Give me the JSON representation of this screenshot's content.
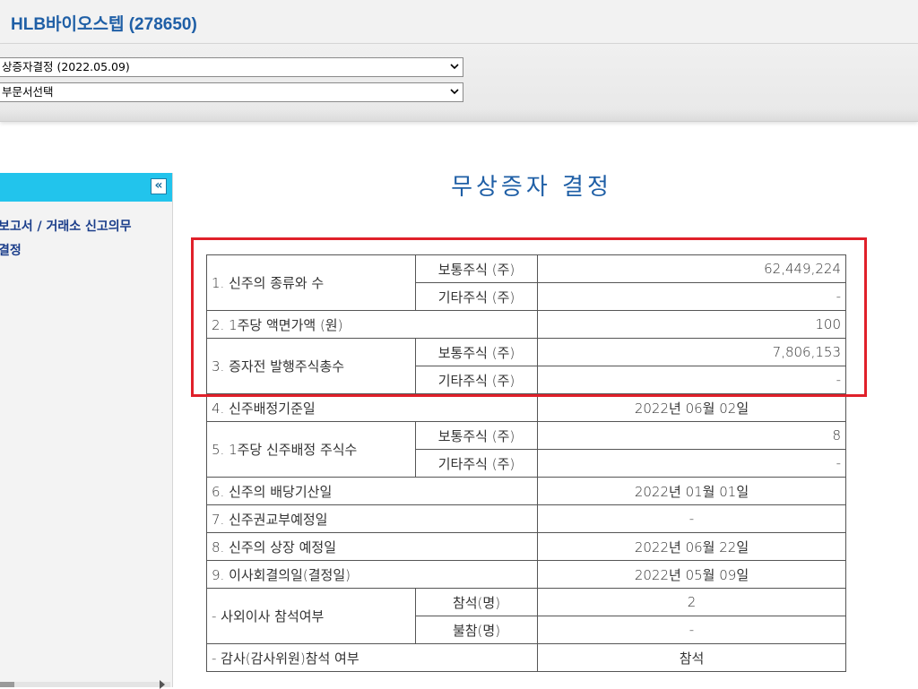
{
  "header": {
    "company_title": "HLB바이오스텝 (278650)"
  },
  "selects": {
    "report": {
      "value": "상증자결정 (2022.05.09)"
    },
    "attachment": {
      "value": "부문서선택"
    }
  },
  "sidebar": {
    "collapse_label": "«",
    "link_line1": "보고서 / 거래소 신고의무",
    "link_line2": "결정"
  },
  "document": {
    "title": "무상증자 결정",
    "rows": [
      {
        "label": "1. 신주의 종류와 수",
        "sub": "보통주식 (주)",
        "value": "62,449,224"
      },
      {
        "sub": "기타주식 (주)",
        "value": "-"
      },
      {
        "label": "2. 1주당 액면가액 (원)",
        "value": "100"
      },
      {
        "label": "3. 증자전 발행주식총수",
        "sub": "보통주식 (주)",
        "value": "7,806,153"
      },
      {
        "sub": "기타주식 (주)",
        "value": "-"
      },
      {
        "label": "4. 신주배정기준일",
        "value": "2022년 06월 02일"
      },
      {
        "label": "5. 1주당 신주배정 주식수",
        "sub": "보통주식 (주)",
        "value": "8"
      },
      {
        "sub": "기타주식 (주)",
        "value": "-"
      },
      {
        "label": "6. 신주의 배당기산일",
        "value": "2022년 01월 01일"
      },
      {
        "label": "7. 신주권교부예정일",
        "value": "-"
      },
      {
        "label": "8. 신주의 상장 예정일",
        "value": "2022년 06월 22일"
      },
      {
        "label": "9. 이사회결의일(결정일)",
        "value": "2022년 05월 09일"
      },
      {
        "label": "- 사외이사 참석여부",
        "sub": "참석(명)",
        "value": "2"
      },
      {
        "sub": "불참(명)",
        "value": "-"
      },
      {
        "label": "- 감사(감사위원)참석 여부",
        "value": "참석"
      }
    ]
  },
  "colors": {
    "title_blue": "#1f5fa6",
    "sidebar_header": "#22c4ec",
    "highlight": "#e0202a"
  },
  "icons": {
    "select_arrow": "chevron-down-icon",
    "collapse": "double-chevron-left-icon"
  }
}
